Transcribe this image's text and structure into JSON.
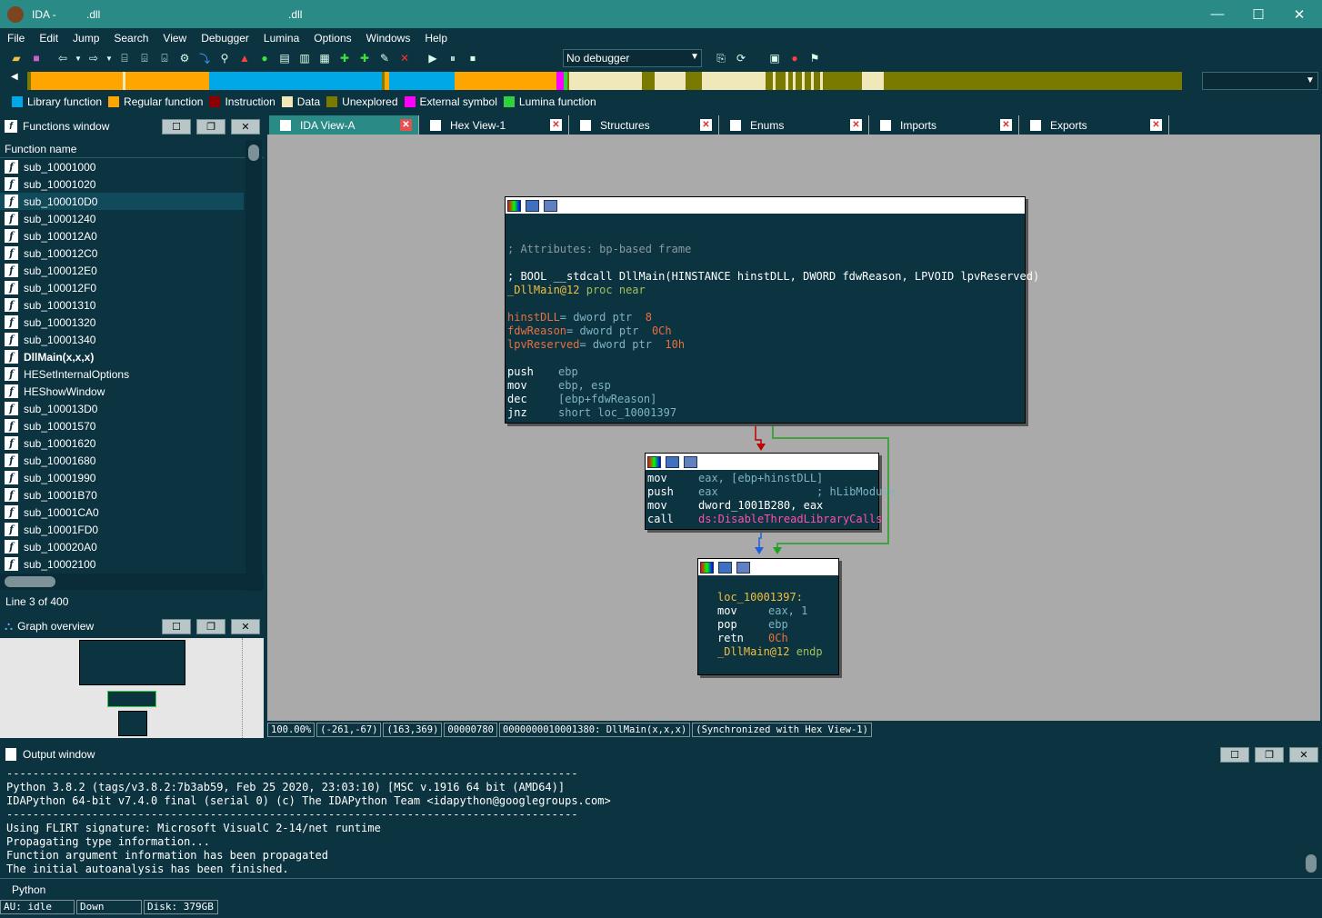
{
  "window": {
    "title": "IDA -          .dll                                                              .dll"
  },
  "menu": [
    "File",
    "Edit",
    "Jump",
    "Search",
    "View",
    "Debugger",
    "Lumina",
    "Options",
    "Windows",
    "Help"
  ],
  "toolbar": {
    "debugger_select": "No debugger"
  },
  "legend": [
    {
      "label": "Library function",
      "color": "#00a8e8"
    },
    {
      "label": "Regular function",
      "color": "#ffa500"
    },
    {
      "label": "Instruction",
      "color": "#8b0000"
    },
    {
      "label": "Data",
      "color": "#f0e8b8"
    },
    {
      "label": "Unexplored",
      "color": "#7a7a00"
    },
    {
      "label": "External symbol",
      "color": "#ff00ff"
    },
    {
      "label": "Lumina function",
      "color": "#30d040"
    }
  ],
  "functions_window": {
    "title": "Functions window",
    "column": "Function name",
    "items": [
      "sub_10001000",
      "sub_10001020",
      "sub_100010D0",
      "sub_10001240",
      "sub_100012A0",
      "sub_100012C0",
      "sub_100012E0",
      "sub_100012F0",
      "sub_10001310",
      "sub_10001320",
      "sub_10001340",
      "DllMain(x,x,x)",
      "HESetInternalOptions",
      "HEShowWindow",
      "sub_100013D0",
      "sub_10001570",
      "sub_10001620",
      "sub_10001680",
      "sub_10001990",
      "sub_10001B70",
      "sub_10001CA0",
      "sub_10001FD0",
      "sub_100020A0",
      "sub_10002100"
    ],
    "line_info": "Line 3 of 400"
  },
  "graph_overview": {
    "title": "Graph overview"
  },
  "tabs": [
    "IDA View-A",
    "Hex View-1",
    "Structures",
    "Enums",
    "Imports",
    "Exports"
  ],
  "node1": {
    "attr": "; Attributes: bp-based frame",
    "proto": "; BOOL __stdcall DllMain(HINSTANCE hinstDLL, DWORD fdwReason, LPVOID lpvReserved)",
    "proc_label": "_DllMain@12",
    "proc_kw": "proc near",
    "vars": [
      {
        "name": "hinstDLL",
        "rest": "= dword ptr ",
        "val": " 8"
      },
      {
        "name": "fdwReason",
        "rest": "= dword ptr ",
        "val": " 0Ch"
      },
      {
        "name": "lpvReserved",
        "rest": "= dword ptr ",
        "val": " 10h"
      }
    ],
    "ins": [
      {
        "m": "push",
        "o": "ebp"
      },
      {
        "m": "mov",
        "o": "ebp, esp"
      },
      {
        "m": "dec",
        "o": "[ebp+fdwReason]"
      },
      {
        "m": "jnz",
        "o": "short loc_10001397"
      }
    ]
  },
  "node2": {
    "ins": [
      {
        "m": "mov",
        "o": "eax, [ebp+hinstDLL]"
      },
      {
        "m": "push",
        "o": "eax               ; hLibModule"
      },
      {
        "m": "mov",
        "o": "dword_1001B280, eax"
      },
      {
        "m": "call",
        "o": "ds:DisableThreadLibraryCalls"
      }
    ]
  },
  "node3": {
    "label": "loc_10001397:",
    "ins": [
      {
        "m": "mov",
        "o": "eax, 1"
      },
      {
        "m": "pop",
        "o": "ebp"
      },
      {
        "m": "retn",
        "o": "0Ch"
      }
    ],
    "endp_label": "_DllMain@12",
    "endp_kw": "endp"
  },
  "status": [
    "100.00%",
    "(-261,-67)",
    "(163,369)",
    "00000780",
    "0000000010001380: DllMain(x,x,x)",
    "(Synchronized with Hex View-1)"
  ],
  "output_window": {
    "title": "Output window",
    "lines": [
      "---------------------------------------------------------------------------------------",
      "Python 3.8.2 (tags/v3.8.2:7b3ab59, Feb 25 2020, 23:03:10) [MSC v.1916 64 bit (AMD64)]",
      "IDAPython 64-bit v7.4.0 final (serial 0) (c) The IDAPython Team <idapython@googlegroups.com>",
      "---------------------------------------------------------------------------------------",
      "Using FLIRT signature: Microsoft VisualC 2-14/net runtime",
      "Propagating type information...",
      "Function argument information has been propagated",
      "The initial autoanalysis has been finished."
    ],
    "input_label": "Python"
  },
  "bottom_status": [
    "AU:  idle",
    "Down",
    "Disk: 379GB"
  ]
}
